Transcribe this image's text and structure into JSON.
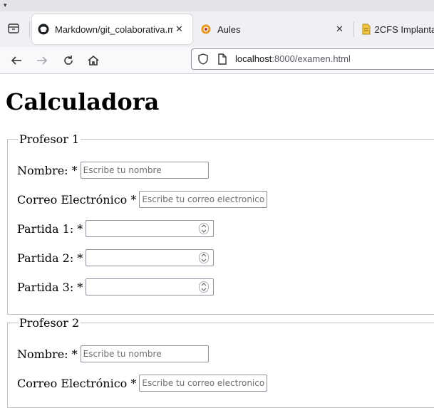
{
  "browser": {
    "tabs": [
      {
        "title": "Markdown/git_colaborativa.m",
        "close": "✕",
        "icon": "github-icon"
      },
      {
        "title": "Aules",
        "close": "✕",
        "icon": "aules-icon"
      },
      {
        "title": "2CFS Implantac",
        "icon": "document-icon"
      }
    ],
    "url": {
      "host": "localhost",
      "rest": ":8000/examen.html"
    }
  },
  "page": {
    "title": "Calculadora",
    "profesores": [
      {
        "legend": "Profesor 1",
        "nombre_label": "Nombre: *",
        "nombre_placeholder": "Escribe tu nombre",
        "correo_label": "Correo Electrónico *",
        "correo_placeholder": "Escribe tu correo electronico",
        "partida1_label": "Partida 1: *",
        "partida2_label": "Partida 2: *",
        "partida3_label": "Partida 3: *"
      },
      {
        "legend": "Profesor 2",
        "nombre_label": "Nombre: *",
        "nombre_placeholder": "Escribe tu nombre",
        "correo_label": "Correo Electrónico *",
        "correo_placeholder": "Escribe tu correo electronico"
      }
    ]
  }
}
